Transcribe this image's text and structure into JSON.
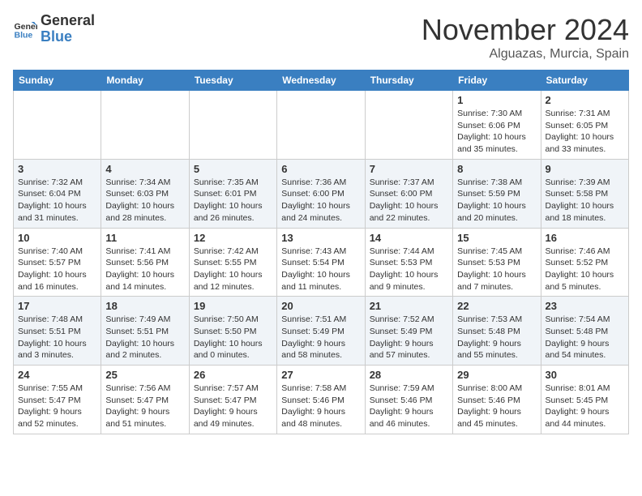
{
  "header": {
    "logo_line1": "General",
    "logo_line2": "Blue",
    "month": "November 2024",
    "location": "Alguazas, Murcia, Spain"
  },
  "weekdays": [
    "Sunday",
    "Monday",
    "Tuesday",
    "Wednesday",
    "Thursday",
    "Friday",
    "Saturday"
  ],
  "weeks": [
    [
      {
        "day": "",
        "info": ""
      },
      {
        "day": "",
        "info": ""
      },
      {
        "day": "",
        "info": ""
      },
      {
        "day": "",
        "info": ""
      },
      {
        "day": "",
        "info": ""
      },
      {
        "day": "1",
        "info": "Sunrise: 7:30 AM\nSunset: 6:06 PM\nDaylight: 10 hours\nand 35 minutes."
      },
      {
        "day": "2",
        "info": "Sunrise: 7:31 AM\nSunset: 6:05 PM\nDaylight: 10 hours\nand 33 minutes."
      }
    ],
    [
      {
        "day": "3",
        "info": "Sunrise: 7:32 AM\nSunset: 6:04 PM\nDaylight: 10 hours\nand 31 minutes."
      },
      {
        "day": "4",
        "info": "Sunrise: 7:34 AM\nSunset: 6:03 PM\nDaylight: 10 hours\nand 28 minutes."
      },
      {
        "day": "5",
        "info": "Sunrise: 7:35 AM\nSunset: 6:01 PM\nDaylight: 10 hours\nand 26 minutes."
      },
      {
        "day": "6",
        "info": "Sunrise: 7:36 AM\nSunset: 6:00 PM\nDaylight: 10 hours\nand 24 minutes."
      },
      {
        "day": "7",
        "info": "Sunrise: 7:37 AM\nSunset: 6:00 PM\nDaylight: 10 hours\nand 22 minutes."
      },
      {
        "day": "8",
        "info": "Sunrise: 7:38 AM\nSunset: 5:59 PM\nDaylight: 10 hours\nand 20 minutes."
      },
      {
        "day": "9",
        "info": "Sunrise: 7:39 AM\nSunset: 5:58 PM\nDaylight: 10 hours\nand 18 minutes."
      }
    ],
    [
      {
        "day": "10",
        "info": "Sunrise: 7:40 AM\nSunset: 5:57 PM\nDaylight: 10 hours\nand 16 minutes."
      },
      {
        "day": "11",
        "info": "Sunrise: 7:41 AM\nSunset: 5:56 PM\nDaylight: 10 hours\nand 14 minutes."
      },
      {
        "day": "12",
        "info": "Sunrise: 7:42 AM\nSunset: 5:55 PM\nDaylight: 10 hours\nand 12 minutes."
      },
      {
        "day": "13",
        "info": "Sunrise: 7:43 AM\nSunset: 5:54 PM\nDaylight: 10 hours\nand 11 minutes."
      },
      {
        "day": "14",
        "info": "Sunrise: 7:44 AM\nSunset: 5:53 PM\nDaylight: 10 hours\nand 9 minutes."
      },
      {
        "day": "15",
        "info": "Sunrise: 7:45 AM\nSunset: 5:53 PM\nDaylight: 10 hours\nand 7 minutes."
      },
      {
        "day": "16",
        "info": "Sunrise: 7:46 AM\nSunset: 5:52 PM\nDaylight: 10 hours\nand 5 minutes."
      }
    ],
    [
      {
        "day": "17",
        "info": "Sunrise: 7:48 AM\nSunset: 5:51 PM\nDaylight: 10 hours\nand 3 minutes."
      },
      {
        "day": "18",
        "info": "Sunrise: 7:49 AM\nSunset: 5:51 PM\nDaylight: 10 hours\nand 2 minutes."
      },
      {
        "day": "19",
        "info": "Sunrise: 7:50 AM\nSunset: 5:50 PM\nDaylight: 10 hours\nand 0 minutes."
      },
      {
        "day": "20",
        "info": "Sunrise: 7:51 AM\nSunset: 5:49 PM\nDaylight: 9 hours\nand 58 minutes."
      },
      {
        "day": "21",
        "info": "Sunrise: 7:52 AM\nSunset: 5:49 PM\nDaylight: 9 hours\nand 57 minutes."
      },
      {
        "day": "22",
        "info": "Sunrise: 7:53 AM\nSunset: 5:48 PM\nDaylight: 9 hours\nand 55 minutes."
      },
      {
        "day": "23",
        "info": "Sunrise: 7:54 AM\nSunset: 5:48 PM\nDaylight: 9 hours\nand 54 minutes."
      }
    ],
    [
      {
        "day": "24",
        "info": "Sunrise: 7:55 AM\nSunset: 5:47 PM\nDaylight: 9 hours\nand 52 minutes."
      },
      {
        "day": "25",
        "info": "Sunrise: 7:56 AM\nSunset: 5:47 PM\nDaylight: 9 hours\nand 51 minutes."
      },
      {
        "day": "26",
        "info": "Sunrise: 7:57 AM\nSunset: 5:47 PM\nDaylight: 9 hours\nand 49 minutes."
      },
      {
        "day": "27",
        "info": "Sunrise: 7:58 AM\nSunset: 5:46 PM\nDaylight: 9 hours\nand 48 minutes."
      },
      {
        "day": "28",
        "info": "Sunrise: 7:59 AM\nSunset: 5:46 PM\nDaylight: 9 hours\nand 46 minutes."
      },
      {
        "day": "29",
        "info": "Sunrise: 8:00 AM\nSunset: 5:46 PM\nDaylight: 9 hours\nand 45 minutes."
      },
      {
        "day": "30",
        "info": "Sunrise: 8:01 AM\nSunset: 5:45 PM\nDaylight: 9 hours\nand 44 minutes."
      }
    ]
  ]
}
